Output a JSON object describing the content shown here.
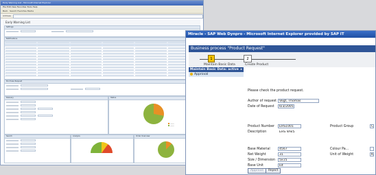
{
  "left_window": {
    "title": "Early Warning List - Microsoft Internet Explorer",
    "menu": "File  Edit  View  Favorites  Tools  Help",
    "toolbar": "Back  ·  Search  Favorites  Media",
    "address_label": "Address",
    "page_title": "Early Warning List",
    "panels": {
      "settings": "Settings",
      "notifications": "Notifications",
      "purchase_request": "Purchase Request",
      "delivery": "Delivery",
      "status": "Status",
      "search": "Search",
      "analysis": "Analysis",
      "order_overview": "Order Overview"
    }
  },
  "right_window": {
    "title": "Miracle - SAP Web Dynpro - Microsoft Internet Explorer provided by SAP IT",
    "process_title": "Business process \"Product Request\"",
    "steps": [
      {
        "number": "1",
        "label": "Maintain Basic Data"
      },
      {
        "number": "2",
        "label": "Create Product"
      }
    ],
    "section_header": "Maintain Basic Data: active",
    "section_sub": "Approval",
    "intro_text": "Please check the product request.",
    "author_label": "Author of request",
    "author_value": "Vogt, Thomas",
    "date_label": "Date of Request",
    "date_value": "6/3/2005",
    "product_number_label": "Product Number",
    "product_number_value": "EHS1001",
    "description_label": "Description",
    "description_value": "EHS 9/9/5",
    "product_group_label": "Product Group",
    "product_group_value": "C",
    "base_material_label": "Base Material",
    "base_material_value": "4567",
    "colour_label": "Colour Pa...",
    "net_weight_label": "Net Weight",
    "net_weight_value": "31",
    "unit_weight_label": "Unit of Weight",
    "unit_weight_value": "K",
    "size_label": "Size / Dimension",
    "size_value": "5x15",
    "base_unit_label": "Base Unit",
    "base_unit_value": "kit",
    "approve_label": "Approve",
    "reject_label": "Reject"
  },
  "colors": {
    "title_bar": "#1f4fa3",
    "band": "#2f5597",
    "step_active": "#f5c400",
    "pie_orange": "#e89025",
    "pie_green": "#8db33e"
  }
}
